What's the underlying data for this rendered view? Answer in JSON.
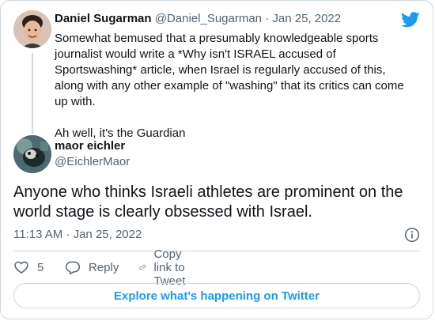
{
  "parent_tweet": {
    "author_name": "Daniel Sugarman",
    "author_handle": "@Daniel_Sugarman",
    "separator": "·",
    "date": "Jan 25, 2022",
    "text_p1": "Somewhat bemused that a presumably knowledgeable sports journalist would write a *Why isn't ISRAEL accused of Sportswashing* article, when Israel is regularly accused of this, along with any other example of \"washing\" that its critics can come up with.",
    "text_p2": "Ah well, it's the Guardian"
  },
  "reply_tweet": {
    "author_name": "maor eichler",
    "author_handle": "@EichlerMaor",
    "text": "Anyone who thinks Israeli athletes are prominent on the world stage is clearly obsessed with Israel.",
    "timestamp": "11:13 AM · Jan 25, 2022"
  },
  "actions": {
    "like_count": "5",
    "reply_label": "Reply",
    "copy_label": "Copy link to Tweet"
  },
  "explore_label": "Explore what's happening on Twitter",
  "colors": {
    "accent": "#1d9bf0",
    "text_primary": "#0f1419",
    "text_secondary": "#536471",
    "border": "#cfd9de"
  },
  "icons": {
    "brand": "twitter-bird-icon",
    "info": "info-icon",
    "like": "heart-icon",
    "reply": "reply-bubble-icon",
    "copy": "link-icon"
  }
}
